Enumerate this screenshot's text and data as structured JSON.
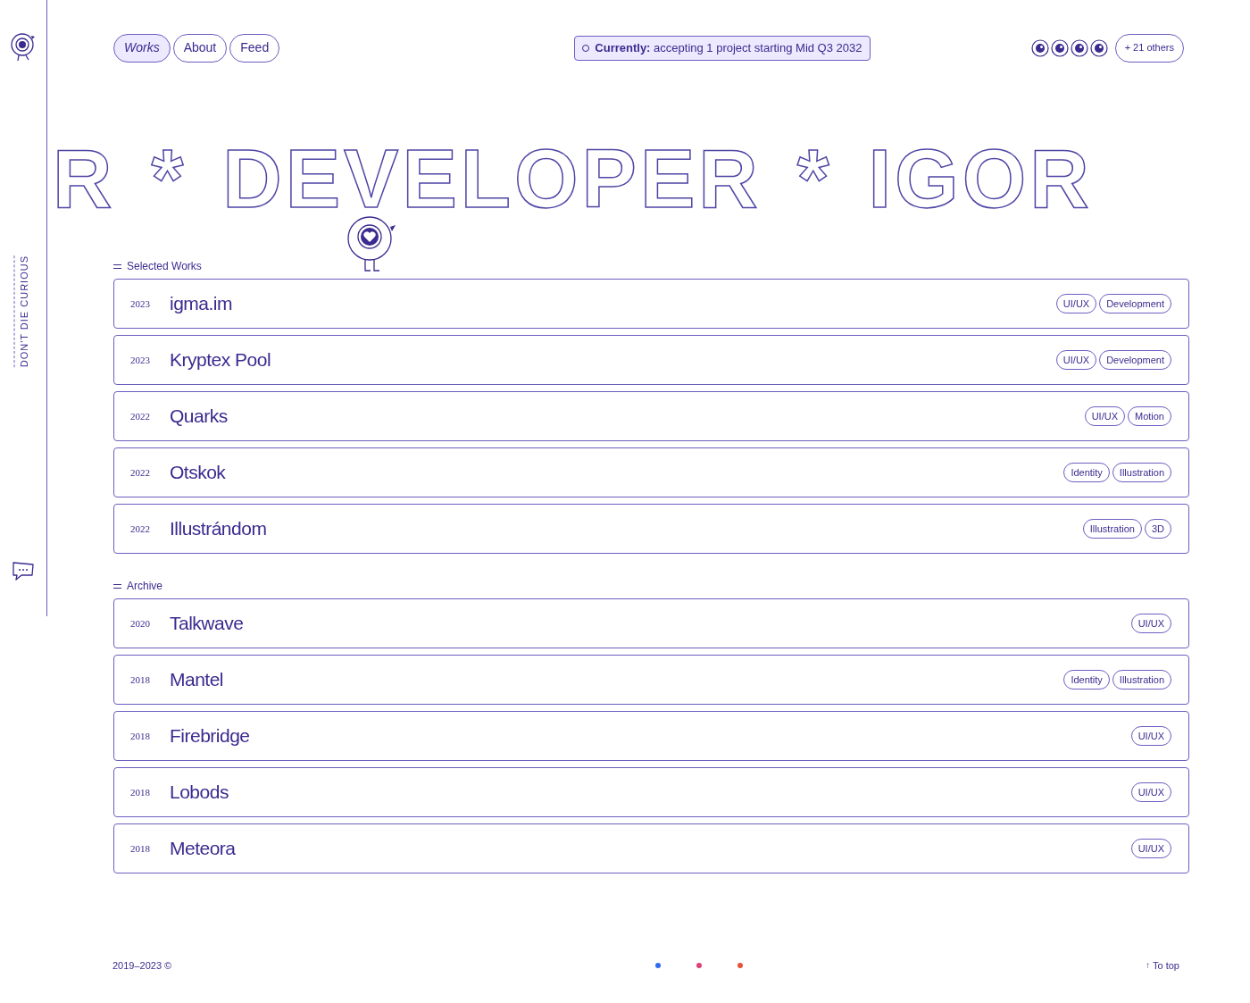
{
  "nav": [
    {
      "label": "Works",
      "selected": true
    },
    {
      "label": "About",
      "selected": false
    },
    {
      "label": "Feed",
      "selected": false
    }
  ],
  "status": {
    "label": "Currently:",
    "text": "accepting 1 project starting Mid Q3 2032"
  },
  "visitors": {
    "count": "+ 21 others"
  },
  "sidebar": {
    "tagline": "DON'T DIE CURIOUS"
  },
  "marquee": [
    "R",
    "*",
    "DEVELOPER",
    "*",
    "IGOR"
  ],
  "sections": [
    {
      "title": "Selected Works",
      "rows": [
        {
          "year": "2023",
          "name": "igma.im",
          "tags": [
            "UI/UX",
            "Development"
          ]
        },
        {
          "year": "2023",
          "name": "Kryptex Pool",
          "tags": [
            "UI/UX",
            "Development"
          ]
        },
        {
          "year": "2022",
          "name": "Quarks",
          "tags": [
            "UI/UX",
            "Motion"
          ]
        },
        {
          "year": "2022",
          "name": "Otskok",
          "tags": [
            "Identity",
            "Illustration"
          ]
        },
        {
          "year": "2022",
          "name": "Illustrándom",
          "tags": [
            "Illustration",
            "3D"
          ]
        }
      ]
    },
    {
      "title": "Archive",
      "rows": [
        {
          "year": "2020",
          "name": "Talkwave",
          "tags": [
            "UI/UX"
          ]
        },
        {
          "year": "2018",
          "name": "Mantel",
          "tags": [
            "Identity",
            "Illustration"
          ]
        },
        {
          "year": "2018",
          "name": "Firebridge",
          "tags": [
            "UI/UX"
          ]
        },
        {
          "year": "2018",
          "name": "Lobods",
          "tags": [
            "UI/UX"
          ]
        },
        {
          "year": "2018",
          "name": "Meteora",
          "tags": [
            "UI/UX"
          ]
        }
      ]
    }
  ],
  "footer": {
    "copyright": "2019–2023 ©",
    "dots": [
      {
        "color": "#2f6bf0"
      },
      {
        "color": "#e0407a"
      },
      {
        "color": "#e8503a"
      }
    ],
    "arrow": "↑",
    "to_top": "To top"
  }
}
